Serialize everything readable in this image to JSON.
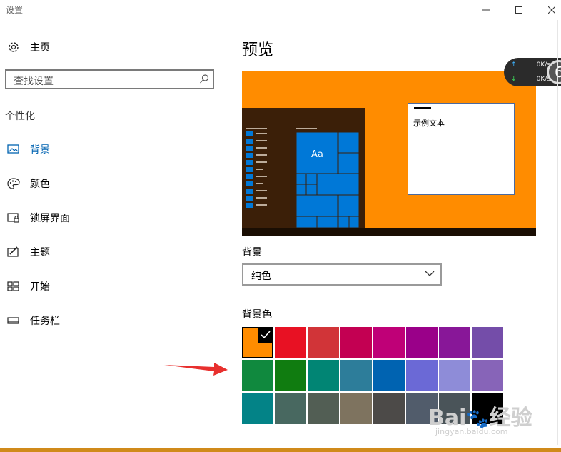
{
  "window": {
    "title": "设置"
  },
  "sidebar": {
    "home": "主页",
    "search_placeholder": "查找设置",
    "section": "个性化",
    "items": [
      {
        "label": "背景",
        "icon": "picture-icon",
        "active": true
      },
      {
        "label": "颜色",
        "icon": "palette-icon",
        "active": false
      },
      {
        "label": "锁屏界面",
        "icon": "lock-screen-icon",
        "active": false
      },
      {
        "label": "主题",
        "icon": "theme-icon",
        "active": false
      },
      {
        "label": "开始",
        "icon": "start-icon",
        "active": false
      },
      {
        "label": "任务栏",
        "icon": "taskbar-icon",
        "active": false
      }
    ]
  },
  "main": {
    "preview_title": "预览",
    "preview_sample_text": "示例文本",
    "preview_tile_text": "Aa",
    "background_label": "背景",
    "background_value": "纯色",
    "color_label": "背景色",
    "selected_color": "#ff8c00",
    "colors": [
      "#ff8c00",
      "#e81123",
      "#d13438",
      "#c30052",
      "#bf0077",
      "#9a0089",
      "#881798",
      "#744da9",
      "#10893e",
      "#107c10",
      "#018574",
      "#2d7d9a",
      "#0063b1",
      "#6b69d6",
      "#8e8cd8",
      "#8764b8",
      "#038387",
      "#486860",
      "#525e54",
      "#7e735f",
      "#4c4a48",
      "#515c6b",
      "#4a5459",
      "#000000"
    ]
  },
  "net_widget": {
    "up": "0K/s",
    "down": "0K/s",
    "badge": "6"
  },
  "watermark": {
    "brand": "Bai",
    "site": "经验",
    "url": "jingyan.baidu.com"
  }
}
